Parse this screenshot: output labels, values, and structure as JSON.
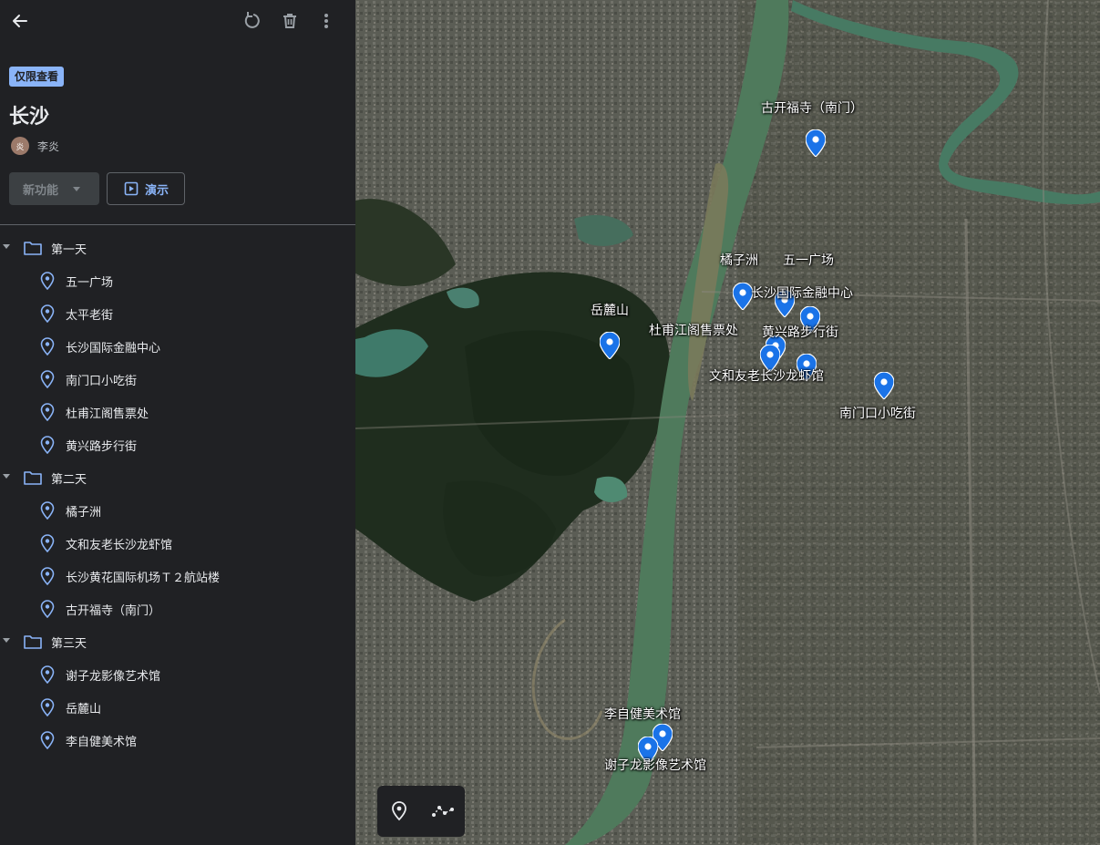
{
  "header": {
    "back_icon": "arrow-left-icon",
    "reset_icon": "reset-icon",
    "delete_icon": "trash-icon",
    "more_icon": "more-vert-icon"
  },
  "project": {
    "badge": "仅限查看",
    "title": "长沙",
    "author": {
      "initial": "炎",
      "name": "李炎"
    },
    "new_feature_label": "新功能",
    "present_label": "演示"
  },
  "folders": [
    {
      "label": "第一天",
      "items": [
        "五一广场",
        "太平老街",
        "长沙国际金融中心",
        "南门口小吃街",
        "杜甫江阁售票处",
        "黄兴路步行街"
      ]
    },
    {
      "label": "第二天",
      "items": [
        "橘子洲",
        "文和友老长沙龙虾馆",
        "长沙黄花国际机场Ｔ２航站楼",
        "古开福寺（南门）"
      ]
    },
    {
      "label": "第三天",
      "items": [
        "谢子龙影像艺术馆",
        "岳麓山",
        "李自健美术馆"
      ]
    }
  ],
  "map": {
    "labels": {
      "kaifu": "古开福寺（南门）",
      "juzizhou": "橘子洲",
      "wuyi": "五一广场",
      "ifc": "长沙国际金融中心",
      "yuelu": "岳麓山",
      "dufu": "杜甫江阁售票处",
      "huangxing": "黄兴路步行街",
      "wenheyou": "文和友老长沙龙虾馆",
      "nanmenkou": "南门口小吃街",
      "lizijian": "李自健美术馆",
      "xieziong": "谢子龙影像艺术馆"
    },
    "pin_color": "#1a73e8",
    "toolbar": {
      "add_marker_icon": "add-marker-icon",
      "draw_line_icon": "draw-line-icon"
    }
  },
  "colors": {
    "accent": "#8ab4f8",
    "panel": "#202124",
    "river": "#4f7a5c"
  }
}
